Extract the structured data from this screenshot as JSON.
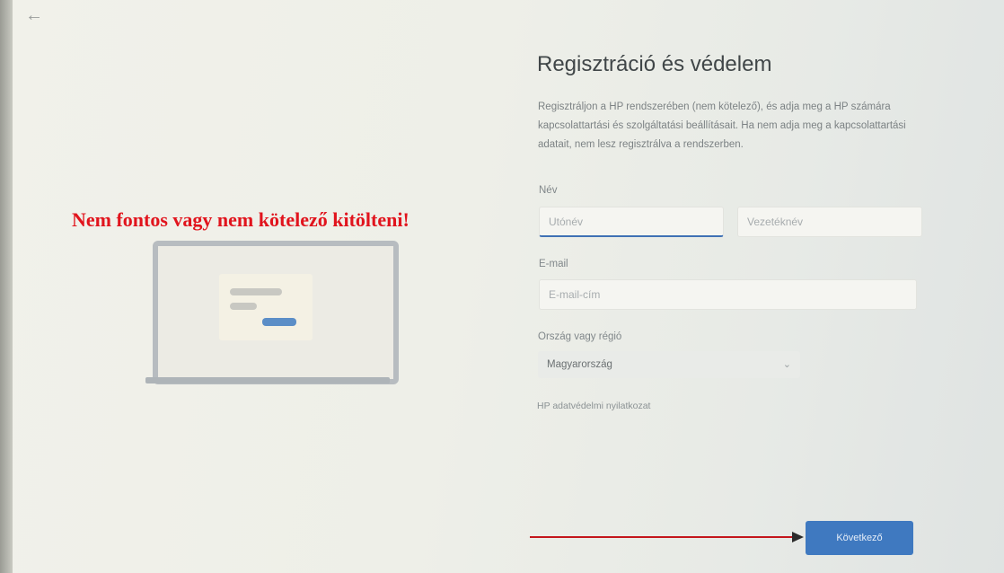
{
  "header": {
    "back_icon": "arrow-left-icon",
    "back_glyph": "←"
  },
  "annotation": {
    "text": "Nem fontos vagy nem kötelező kitölteni!",
    "color": "#e1141d"
  },
  "main": {
    "title": "Regisztráció és védelem",
    "description": "Regisztráljon a HP rendszerében (nem kötelező), és adja meg a HP számára kapcsolattartási és szolgáltatási beállításait. Ha nem adja meg a kapcsolattartási adatait, nem lesz regisztrálva a rendszerben.",
    "name": {
      "label": "Név",
      "first_placeholder": "Utónév",
      "last_placeholder": "Vezetéknév"
    },
    "email": {
      "label": "E-mail",
      "placeholder": "E-mail-cím"
    },
    "country": {
      "label": "Ország vagy régió",
      "value": "Magyarország",
      "chevron": "⌄"
    },
    "privacy_link": "HP adatvédelmi nyilatkozat",
    "next_label": "Következő"
  },
  "colors": {
    "accent": "#3f79c0",
    "annotation": "#e1141d"
  }
}
